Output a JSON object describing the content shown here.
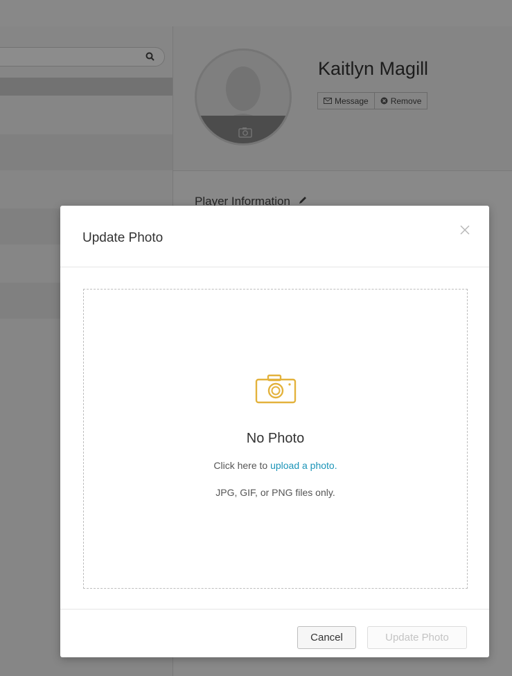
{
  "profile": {
    "name": "Kaitlyn Magill",
    "message_label": "Message",
    "remove_label": "Remove",
    "section_title": "Player Information"
  },
  "modal": {
    "title": "Update Photo",
    "no_photo": "No Photo",
    "upload_prefix": "Click here to ",
    "upload_link": "upload a photo.",
    "file_types": "JPG, GIF, or PNG files only.",
    "cancel_label": "Cancel",
    "update_label": "Update Photo"
  },
  "icons": {
    "search": "search-icon",
    "avatar_camera": "camera-icon",
    "message": "envelope-icon",
    "remove": "remove-circle-icon",
    "edit": "pencil-icon",
    "close": "close-icon",
    "dropzone_camera": "camera-icon"
  },
  "colors": {
    "accent_link": "#1b94b8",
    "camera_icon": "#e3b23c",
    "overlay": "rgba(0,0,0,0.45)"
  }
}
